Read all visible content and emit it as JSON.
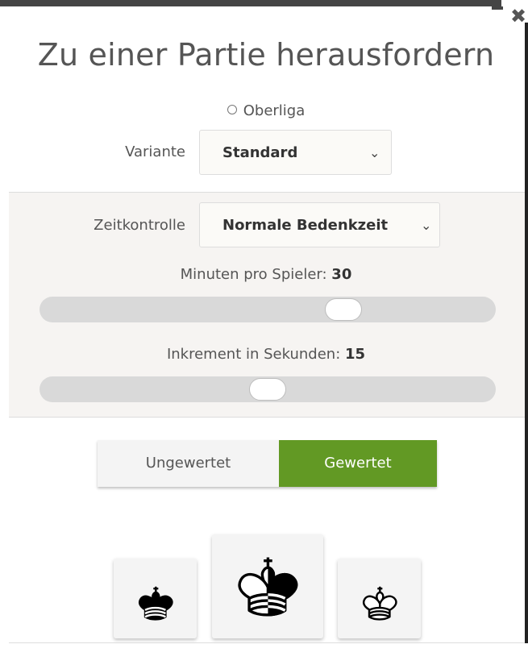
{
  "dialog": {
    "title": "Zu einer Partie herausfordern",
    "close_glyph": "✖"
  },
  "form": {
    "league_label": "Oberliga",
    "variant": {
      "label": "Variante",
      "value": "Standard"
    },
    "time_control": {
      "label": "Zeitkontrolle",
      "value": "Normale Bedenkzeit"
    },
    "minutes": {
      "label": "Minuten pro Spieler: ",
      "value": "30",
      "position_fraction": 0.67
    },
    "increment": {
      "label": "Inkrement in Sekunden: ",
      "value": "15",
      "position_fraction": 0.5
    },
    "mode": {
      "options": [
        "Ungewertet",
        "Gewertet"
      ],
      "selected": "Gewertet",
      "selected_color": "#629924"
    }
  },
  "icons": {
    "chevron": "chevron-down-icon",
    "colors": [
      "black-king-icon",
      "random-king-icon",
      "white-king-icon"
    ]
  }
}
